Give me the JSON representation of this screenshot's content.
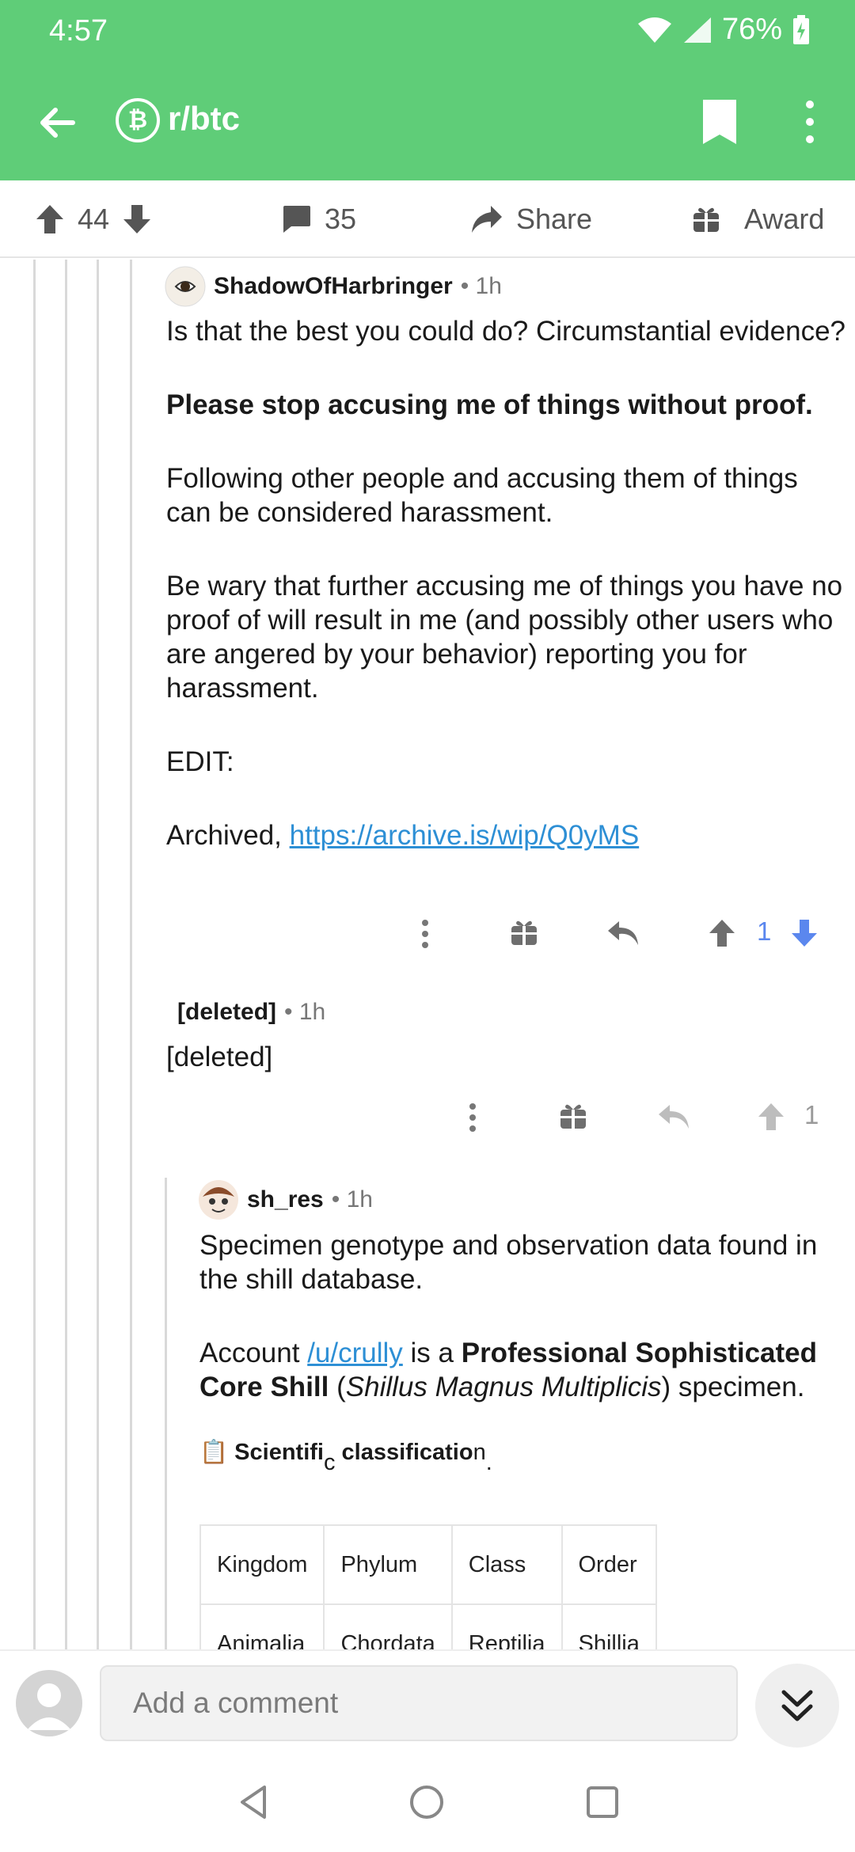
{
  "status_bar": {
    "time": "4:57",
    "battery": "76%"
  },
  "app_bar": {
    "subreddit": "r/btc",
    "badge": "₿"
  },
  "post_actions": {
    "upvotes": "44",
    "comments": "35",
    "share": "Share",
    "award": "Award"
  },
  "comments": [
    {
      "username": "ShadowOfHarbringer",
      "time": "• 1h",
      "paragraphs": [
        "Is that the best you could do? Circumstantial evidence?",
        "Please stop accusing me of things without proof.",
        "Following other people and accusing them of things can be considered harassment.",
        "Be wary that further accusing me of things you have no proof of will result in me (and possibly other users who are angered by your behavior) reporting you for harassment.",
        "EDIT:"
      ],
      "archived_label": "Archived, ",
      "archived_link": "https://archive.is/wip/Q0yMS",
      "score": "1"
    },
    {
      "username": "[deleted]",
      "time": "• 1h",
      "body": "[deleted]",
      "score": "1"
    },
    {
      "username": "sh_res",
      "time": "• 1h",
      "paragraph1": "Specimen genotype and observation data found in the shill database.",
      "p2_a": "Account ",
      "p2_link": "/u/crully",
      "p2_b": " is a ",
      "p2_bold": "Professional Sophisticated Core Shill",
      "p2_c": " (",
      "p2_italic": "Shillus Magnus Multiplicis",
      "p2_d": ") specimen.",
      "classification_icon": "📋",
      "classification_text_1": "Scientifi",
      "classification_sub": "c",
      "classification_text_2": " classificatio",
      "classification_text_3": "n",
      "classification_sub2": ".",
      "table_headers": [
        "Kingdom",
        "Phylum",
        "Class",
        "Order"
      ],
      "table_row": [
        "Animalia",
        "Chordata",
        "Reptilia",
        "Shillia"
      ]
    }
  ],
  "composer": {
    "placeholder": "Add a comment"
  },
  "colors": {
    "brand_green": "#5fcd78",
    "upvote_blue": "#5b87ee",
    "link_blue": "#2d8fd5"
  }
}
